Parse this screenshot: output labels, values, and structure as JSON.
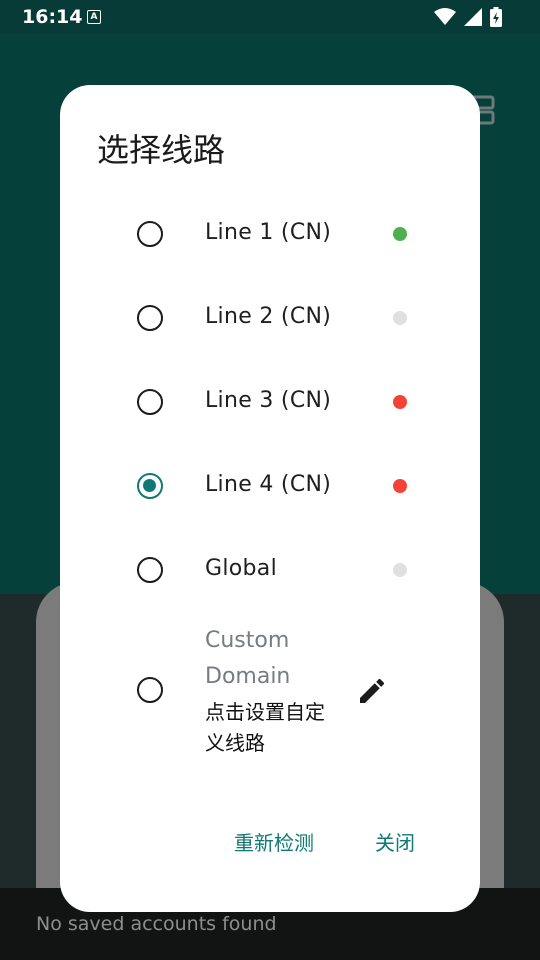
{
  "status_bar": {
    "time": "16:14",
    "notification_letter": "A"
  },
  "dialog": {
    "title": "选择线路",
    "options": [
      {
        "label": "Line 1 (CN)",
        "selected": false,
        "status_color": "#4caf50"
      },
      {
        "label": "Line 2 (CN)",
        "selected": false,
        "status_color": "#e0e0e0"
      },
      {
        "label": "Line 3 (CN)",
        "selected": false,
        "status_color": "#f44336"
      },
      {
        "label": "Line 4 (CN)",
        "selected": true,
        "status_color": "#f44336"
      },
      {
        "label": "Global",
        "selected": false,
        "status_color": "#e0e0e0"
      }
    ],
    "custom": {
      "title": "Custom Domain",
      "subtitle": "点击设置自定义线路"
    },
    "actions": {
      "recheck": "重新检测",
      "close": "关闭"
    }
  },
  "snackbar": {
    "text": "No saved accounts found"
  },
  "colors": {
    "accent": "#0e7a73",
    "app_bar": "#06403b"
  }
}
